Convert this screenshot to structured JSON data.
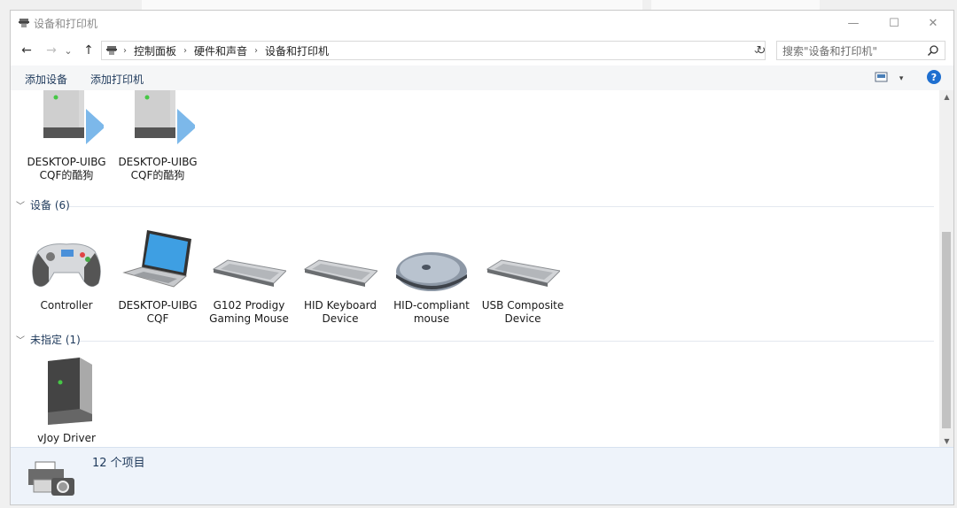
{
  "window": {
    "title": "设备和打印机",
    "controls": {
      "minimize": "—",
      "maximize": "☐",
      "close": "✕"
    }
  },
  "address": {
    "back": "←",
    "forward": "→",
    "recent": "⌄",
    "up": "↑",
    "breadcrumbs": [
      "控制面板",
      "硬件和声音",
      "设备和打印机"
    ],
    "dropdown": "⌄",
    "refresh": "↻",
    "search_placeholder": "搜索\"设备和打印机\""
  },
  "commands": {
    "add_device": "添加设备",
    "add_printer": "添加打印机",
    "view_caret": "▾",
    "help": "?"
  },
  "groups": {
    "printers_items": [
      {
        "label": "DESKTOP-UIBG\nCQF的酷狗",
        "icon": "server-arrow-icon"
      },
      {
        "label": "DESKTOP-UIBG\nCQF的酷狗",
        "icon": "server-arrow-icon"
      }
    ],
    "devices": {
      "header": "设备 (6)",
      "items": [
        {
          "label": "Controller",
          "icon": "gamepad-icon"
        },
        {
          "label": "DESKTOP-UIBG\nCQF",
          "icon": "laptop-icon"
        },
        {
          "label": "G102 Prodigy\nGaming Mouse",
          "icon": "keyboard-icon"
        },
        {
          "label": "HID Keyboard\nDevice",
          "icon": "keyboard-icon"
        },
        {
          "label": "HID-compliant\nmouse",
          "icon": "mouse-icon"
        },
        {
          "label": "USB Composite\nDevice",
          "icon": "keyboard-icon"
        }
      ]
    },
    "unspecified": {
      "header": "未指定 (1)",
      "items": [
        {
          "label": "vJoy Driver",
          "icon": "server-icon"
        }
      ]
    }
  },
  "details": {
    "count": "12 个项目"
  }
}
